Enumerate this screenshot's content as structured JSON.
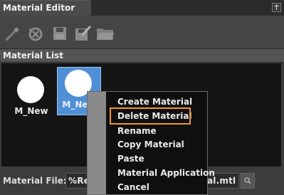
{
  "window": {
    "title": "Material Editor",
    "dock_icon": "dock-pin-icon"
  },
  "toolbar": {
    "buttons": [
      {
        "name": "eyedropper-button",
        "icon": "eyedropper-icon"
      },
      {
        "name": "reset-button",
        "icon": "reset-icon"
      },
      {
        "name": "save-button",
        "icon": "save-icon"
      },
      {
        "name": "edit-button",
        "icon": "edit-icon"
      },
      {
        "name": "open-folder-button",
        "icon": "folder-icon"
      }
    ]
  },
  "material_list": {
    "header": "Material List",
    "items": [
      {
        "label": "M_New",
        "selected": false
      },
      {
        "label": "M_New",
        "selected": true
      }
    ]
  },
  "file": {
    "label": "Material File:",
    "value_visible_start": "%Re",
    "value_visible_end": "al.mtl"
  },
  "context_menu": {
    "items": [
      "Create Material",
      "Delete Material",
      "Rename",
      "Copy Material",
      "Paste",
      "Material Application",
      "Cancel"
    ],
    "highlighted_index": 1
  },
  "colors": {
    "selection": "#4f8fd6",
    "highlight_outline": "#f0962e",
    "list_background": "#141414"
  }
}
